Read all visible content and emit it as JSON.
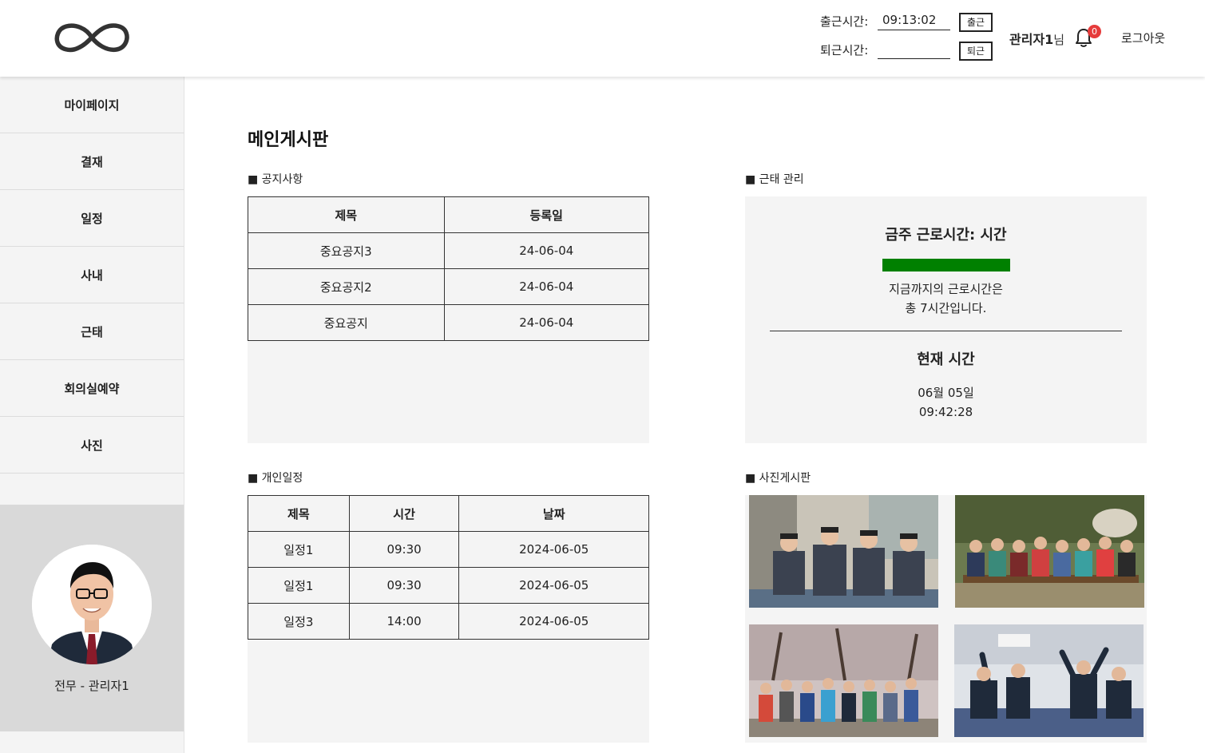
{
  "header": {
    "checkin_label": "출근시간:",
    "checkin_value": "09:13:02",
    "checkin_button": "출근",
    "checkout_label": "퇴근시간:",
    "checkout_value": "",
    "checkout_button": "퇴근",
    "user_name": "관리자1",
    "user_suffix": "님",
    "notification_count": "0",
    "logout": "로그아웃"
  },
  "sidebar": {
    "items": [
      {
        "label": "마이페이지"
      },
      {
        "label": "결재"
      },
      {
        "label": "일정"
      },
      {
        "label": "사내"
      },
      {
        "label": "근태"
      },
      {
        "label": "회의실예약"
      },
      {
        "label": "사진"
      }
    ],
    "profile_name": "전무 - 관리자1"
  },
  "main": {
    "title": "메인게시판",
    "notice": {
      "label": "■ 공지사항",
      "columns": [
        "제목",
        "등록일"
      ],
      "rows": [
        [
          "중요공지3",
          "24-06-04"
        ],
        [
          "중요공지2",
          "24-06-04"
        ],
        [
          "중요공지",
          "24-06-04"
        ]
      ]
    },
    "schedule": {
      "label": "■ 개인일정",
      "columns": [
        "제목",
        "시간",
        "날짜"
      ],
      "rows": [
        [
          "일정1",
          "09:30",
          "2024-06-05"
        ],
        [
          "일정1",
          "09:30",
          "2024-06-05"
        ],
        [
          "일정3",
          "14:00",
          "2024-06-05"
        ]
      ]
    },
    "attendance": {
      "label": "■ 근태 관리",
      "week_title": "금주 근로시간: 시간",
      "progress_fraction": 1.0,
      "worked_line1": "지금까지의 근로시간은",
      "worked_line2": "총 7시간입니다.",
      "now_title": "현재 시간",
      "now_date": "06월 05일",
      "now_time": "09:42:28"
    },
    "photos": {
      "label": "■ 사진게시판",
      "count": 4
    }
  },
  "colors": {
    "accent_green": "#008000",
    "badge_red": "#e63b3b",
    "panel_gray": "#f4f4f4"
  }
}
